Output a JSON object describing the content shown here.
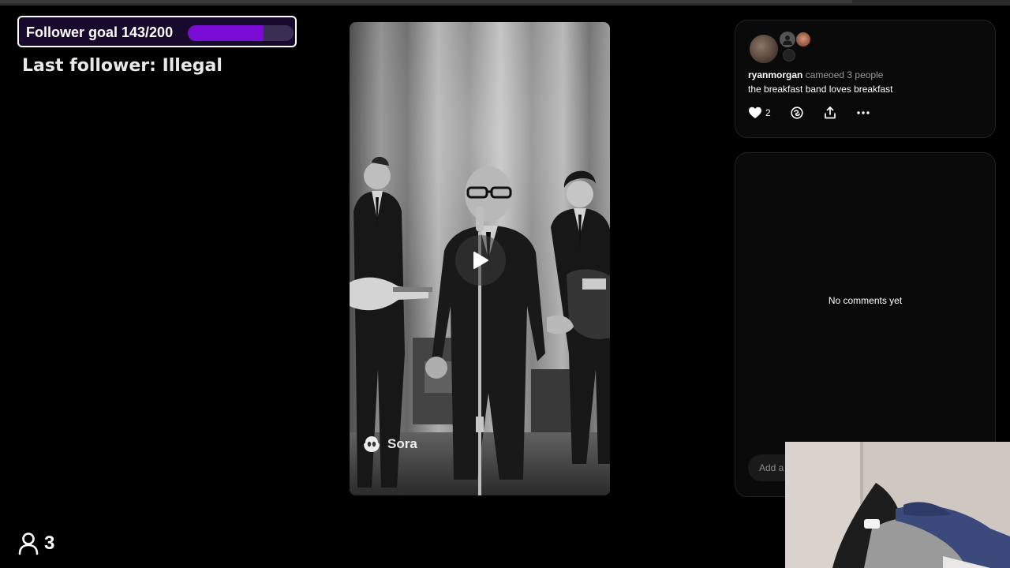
{
  "overlay": {
    "goal_label": "Follower goal 143/200",
    "goal_current": 143,
    "goal_target": 200,
    "goal_progress_fraction": 0.715,
    "last_follower": "Last follower: Illegal",
    "viewer_count": "3"
  },
  "video": {
    "watermark": "Sora",
    "play_icon": "play-icon"
  },
  "post": {
    "username": "ryanmorgan",
    "meta": "cameoed 3 people",
    "caption": "the breakfast band loves breakfast",
    "like_count": "2",
    "icons": [
      "heart-icon",
      "remix-icon",
      "share-icon",
      "more-icon"
    ]
  },
  "comments": {
    "empty_text": "No comments yet",
    "input_placeholder": "Add a comment..."
  },
  "colors": {
    "goal_fill": "#7a0bd4",
    "goal_track": "#3a2f52",
    "card_bg": "#0a0a0a",
    "page_bg": "#000000"
  }
}
